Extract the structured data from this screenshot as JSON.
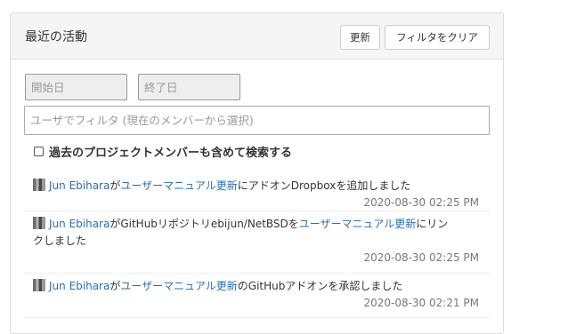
{
  "panel": {
    "title": "最近の活動",
    "refresh_label": "更新",
    "clear_filter_label": "フィルタをクリア"
  },
  "filters": {
    "start_date_placeholder": "開始日",
    "end_date_placeholder": "終了日",
    "member_filter_placeholder": "ユーザでフィルタ (現在のメンバーから選択)",
    "include_past_members_label": "過去のプロジェクトメンバーも含めて検索する",
    "include_past_members_checked": false
  },
  "activities": [
    {
      "user": "Jun Ebihara",
      "ga": "が",
      "doc": "ユーザーマニュアル更新",
      "text": "にアドオンDropboxを追加しました",
      "timestamp": "2020-08-30 02:25 PM"
    },
    {
      "user": "Jun Ebihara",
      "pre": "がGitHubリポジトリebijun/NetBSDを",
      "doc": "ユーザーマニュアル更新",
      "text": "にリンクしました",
      "timestamp": "2020-08-30 02:25 PM"
    },
    {
      "user": "Jun Ebihara",
      "ga": "が",
      "doc": "ユーザーマニュアル更新",
      "text": "のGitHubアドオンを承認しました",
      "timestamp": "2020-08-30 02:21 PM"
    }
  ],
  "colors": {
    "link": "#2a6ebb",
    "header_bg": "#f5f5f5",
    "timestamp": "#777777"
  },
  "icons": {
    "avatar": "user-avatar-icon",
    "checkbox": "checkbox-icon"
  }
}
